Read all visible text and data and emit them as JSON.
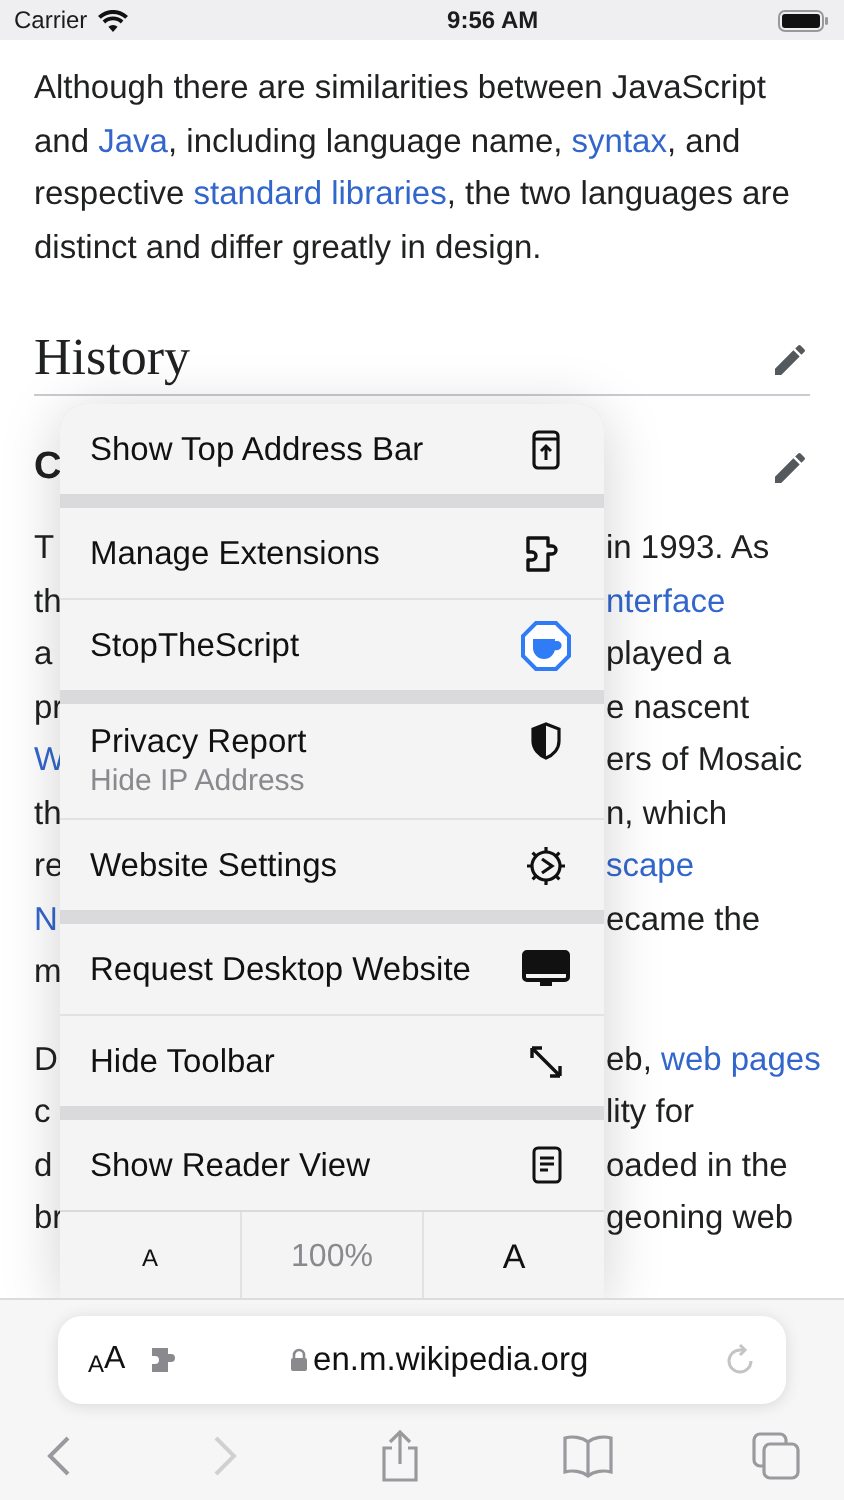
{
  "status_bar": {
    "carrier": "Carrier",
    "time": "9:56 AM"
  },
  "article": {
    "intro": [
      {
        "text": "Although there are similarities between JavaScript and ",
        "link": false
      },
      {
        "text": "Java",
        "link": true
      },
      {
        "text": ", including language name, ",
        "link": false
      },
      {
        "text": "syntax",
        "link": true
      },
      {
        "text": ", and respective ",
        "link": false
      },
      {
        "text": "standard libraries",
        "link": true
      },
      {
        "text": ", the two languages are distinct and differ greatly in design.",
        "link": false
      }
    ],
    "heading": "History",
    "subheading": "C",
    "paragraphs": [
      [
        {
          "left": [
            {
              "text": "T",
              "link": false
            }
          ],
          "right": [
            {
              "text": "in 1993. As",
              "link": false
            }
          ]
        },
        {
          "left": [
            {
              "text": "th",
              "link": false
            }
          ],
          "right": [
            {
              "text": "nterface",
              "link": true
            }
          ]
        },
        {
          "left": [
            {
              "text": "a",
              "link": false
            }
          ],
          "right": [
            {
              "text": "played a",
              "link": false
            }
          ]
        },
        {
          "left": [
            {
              "text": "pr",
              "link": false
            }
          ],
          "right": [
            {
              "text": "e nascent",
              "link": false
            }
          ]
        },
        {
          "left": [
            {
              "text": "W",
              "link": true
            }
          ],
          "right": [
            {
              "text": "ers of Mosaic",
              "link": false
            }
          ]
        },
        {
          "left": [
            {
              "text": "th",
              "link": false
            }
          ],
          "right": [
            {
              "text": "n, which",
              "link": false
            }
          ]
        },
        {
          "left": [
            {
              "text": "re",
              "link": false
            }
          ],
          "right": [
            {
              "text": "scape",
              "link": true
            }
          ]
        },
        {
          "left": [
            {
              "text": "N",
              "link": true
            }
          ],
          "right": [
            {
              "text": "ecame the",
              "link": false
            }
          ]
        },
        {
          "left": [
            {
              "text": "m",
              "link": false
            }
          ]
        }
      ],
      [
        {
          "left": [
            {
              "text": "D",
              "link": false
            }
          ],
          "right": [
            {
              "text": "eb, ",
              "link": false
            },
            {
              "text": "web pages",
              "link": true
            }
          ]
        },
        {
          "left": [
            {
              "text": "c",
              "link": false
            }
          ],
          "right": [
            {
              "text": "lity for",
              "link": false
            }
          ]
        },
        {
          "left": [
            {
              "text": "d",
              "link": false
            }
          ],
          "right": [
            {
              "text": "oaded in the",
              "link": false
            }
          ]
        },
        {
          "left": [
            {
              "text": "br",
              "link": false
            }
          ],
          "right": [
            {
              "text": "geoning web",
              "link": false
            }
          ]
        }
      ]
    ]
  },
  "menu": {
    "groups": [
      [
        {
          "label": "Show Top Address Bar"
        }
      ],
      [
        {
          "label": "Manage Extensions"
        },
        {
          "label": "StopTheScript"
        }
      ],
      [
        {
          "label": "Privacy Report",
          "subtitle": "Hide IP Address"
        },
        {
          "label": "Website Settings"
        }
      ],
      [
        {
          "label": "Request Desktop Website"
        },
        {
          "label": "Hide Toolbar"
        }
      ],
      [
        {
          "label": "Show Reader View"
        }
      ]
    ],
    "font_row": {
      "decrease": "A",
      "zoom": "100%",
      "increase": "A"
    }
  },
  "address_bar": {
    "format_small": "A",
    "format_large": "A",
    "url": "en.m.wikipedia.org"
  }
}
